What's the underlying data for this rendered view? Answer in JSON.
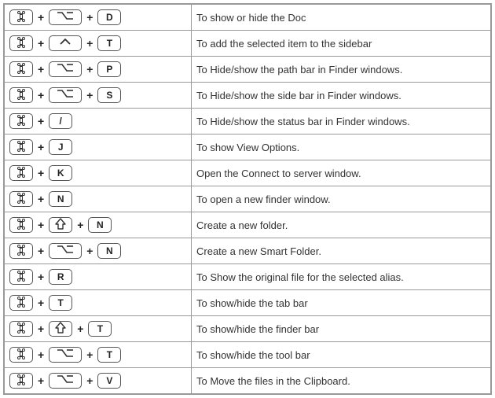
{
  "plus": "+",
  "rows": [
    {
      "keys": [
        "cmd",
        "opt",
        "D"
      ],
      "desc": "To show or hide the Doc"
    },
    {
      "keys": [
        "cmd",
        "ctrl",
        "T"
      ],
      "desc": "To add the selected item to the sidebar"
    },
    {
      "keys": [
        "cmd",
        "opt",
        "P"
      ],
      "desc": "To Hide/show the path bar in Finder windows."
    },
    {
      "keys": [
        "cmd",
        "opt",
        "S"
      ],
      "desc": "To Hide/show the side bar in Finder windows."
    },
    {
      "keys": [
        "cmd",
        "/"
      ],
      "desc": "To Hide/show the status bar in Finder windows."
    },
    {
      "keys": [
        "cmd",
        "J"
      ],
      "desc": "To show View Options."
    },
    {
      "keys": [
        "cmd",
        "K"
      ],
      "desc": "Open the Connect to server window."
    },
    {
      "keys": [
        "cmd",
        "N"
      ],
      "desc": "To open a new finder window."
    },
    {
      "keys": [
        "cmd",
        "shift",
        "N"
      ],
      "desc": "Create a new folder."
    },
    {
      "keys": [
        "cmd",
        "opt",
        "N"
      ],
      "desc": "Create a new Smart Folder."
    },
    {
      "keys": [
        "cmd",
        "R"
      ],
      "desc": "To Show the original file for the selected alias."
    },
    {
      "keys": [
        "cmd",
        "T"
      ],
      "desc": "To show/hide the tab bar"
    },
    {
      "keys": [
        "cmd",
        "shift",
        "T"
      ],
      "desc": "To show/hide the finder bar"
    },
    {
      "keys": [
        "cmd",
        "opt",
        "T"
      ],
      "desc": "To show/hide the tool bar"
    },
    {
      "keys": [
        "cmd",
        "opt",
        "V"
      ],
      "desc": "To Move the files in the Clipboard."
    }
  ]
}
